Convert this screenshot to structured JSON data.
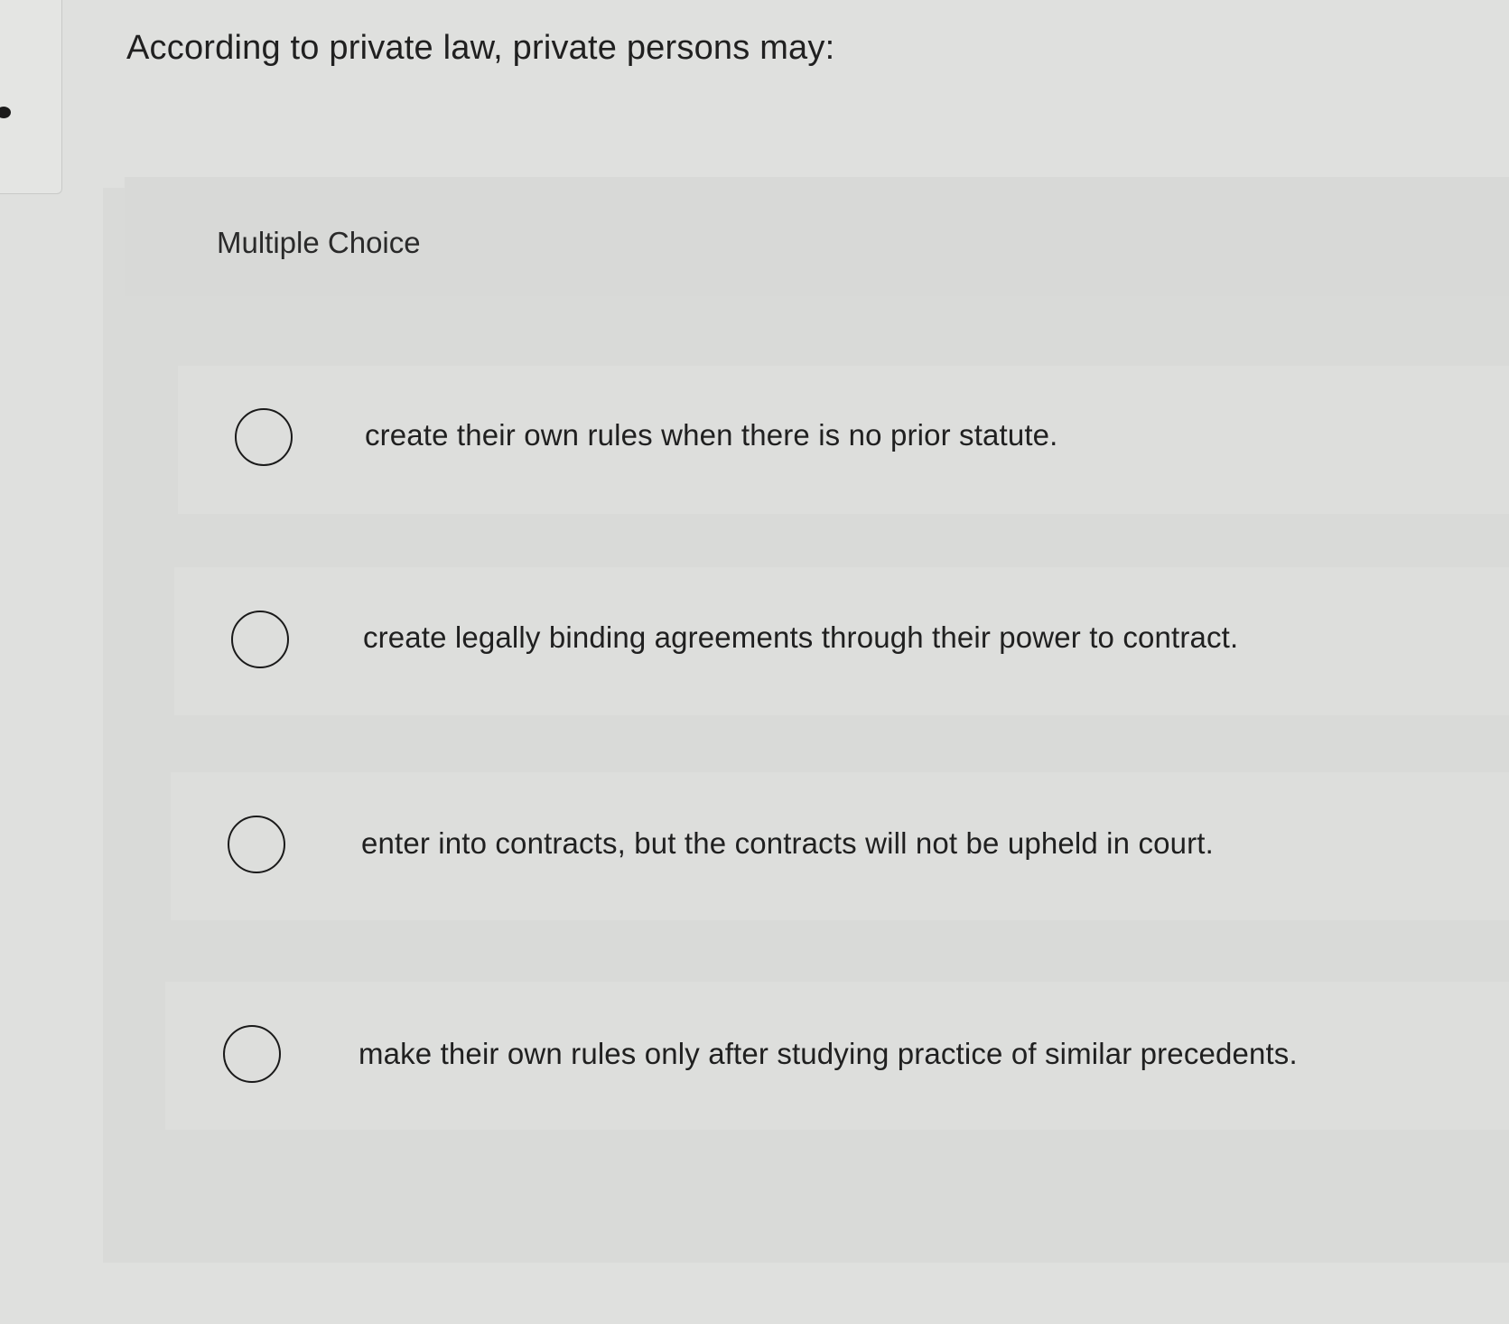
{
  "question": {
    "text": "According to private law, private persons may:"
  },
  "panel": {
    "label": "Multiple Choice"
  },
  "options": [
    {
      "label": "create their own rules when there is no prior statute.",
      "selected": false
    },
    {
      "label": "create legally binding agreements through their power to contract.",
      "selected": false
    },
    {
      "label": "enter into contracts, but the contracts will not be upheld in court.",
      "selected": false
    },
    {
      "label": "make their own rules only after studying practice of similar precedents.",
      "selected": false
    }
  ]
}
